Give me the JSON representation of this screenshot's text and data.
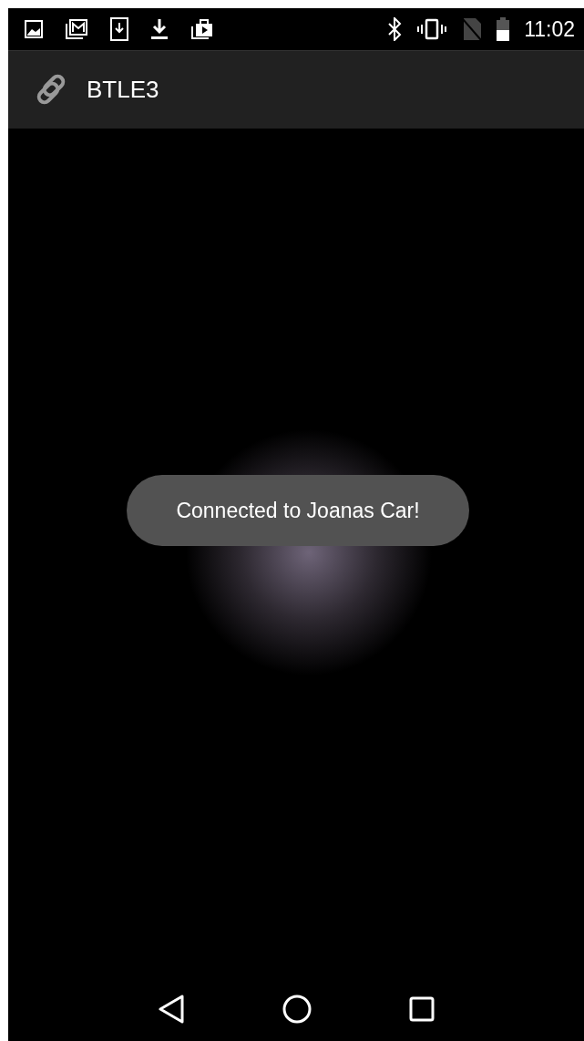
{
  "status_bar": {
    "time": "11:02"
  },
  "app_bar": {
    "title": "BTLE3"
  },
  "toast": {
    "message": "Connected to Joanas Car!"
  }
}
